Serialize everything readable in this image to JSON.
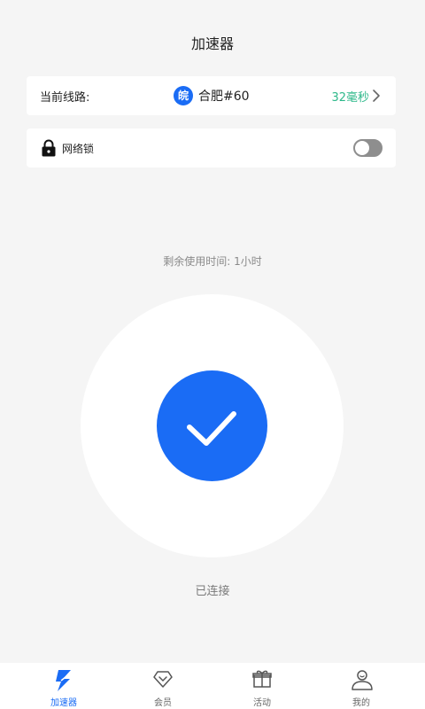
{
  "header": {
    "title": "加速器"
  },
  "route": {
    "label": "当前线路:",
    "region_badge": "皖",
    "name": "合肥#60",
    "latency": "32毫秒",
    "accent": "#1a6cf5",
    "latency_color": "#2db88a"
  },
  "network_lock": {
    "label": "网络锁",
    "enabled": false
  },
  "remaining_time": "剩余使用时间: 1小时",
  "connection": {
    "status": "已连接",
    "color": "#1a6cf5"
  },
  "tabs": [
    {
      "label": "加速器",
      "icon": "lightning-icon",
      "active": true
    },
    {
      "label": "会员",
      "icon": "diamond-icon",
      "active": false
    },
    {
      "label": "活动",
      "icon": "gift-icon",
      "active": false
    },
    {
      "label": "我的",
      "icon": "user-icon",
      "active": false
    }
  ]
}
